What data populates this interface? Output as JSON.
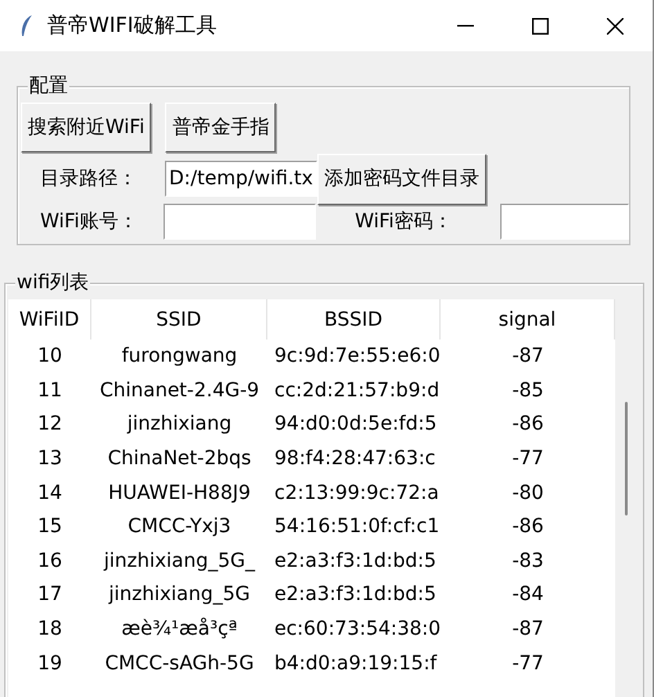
{
  "window": {
    "title": "普帝WIFI破解工具"
  },
  "config": {
    "title": "配置",
    "buttons": [
      "搜索附近WiFi",
      "普帝金手指"
    ],
    "path_label": "目录路径：",
    "path_value": "D:/temp/wifi.tx",
    "add_button": "添加密码文件目录",
    "account_label": "WiFi账号：",
    "password_label": "WiFi密码："
  },
  "wifi_list": {
    "title": "wifi列表",
    "columns": [
      "WiFiID",
      "SSID",
      "BSSID",
      "signal"
    ],
    "rows": [
      [
        "10",
        "furongwang",
        "9c:9d:7e:55:e6:0",
        "-87"
      ],
      [
        "11",
        "Chinanet-2.4G-9",
        "cc:2d:21:57:b9:d",
        "-85"
      ],
      [
        "12",
        "jinzhixiang",
        "94:d0:0d:5e:fd:5",
        "-86"
      ],
      [
        "13",
        "ChinaNet-2bqs",
        "98:f4:28:47:63:c",
        "-77"
      ],
      [
        "14",
        "HUAWEI-H88J9",
        "c2:13:99:9c:72:a",
        "-80"
      ],
      [
        "15",
        "CMCC-Yxj3",
        "54:16:51:0f:cf:c1",
        "-86"
      ],
      [
        "16",
        "jinzhixiang_5G_",
        "e2:a3:f3:1d:bd:5",
        "-83"
      ],
      [
        "17",
        "jinzhixiang_5G",
        "e2:a3:f3:1d:bd:5",
        "-84"
      ],
      [
        "18",
        "æè¾¹æå³çª",
        "ec:60:73:54:38:0",
        "-87"
      ],
      [
        "19",
        "CMCC-sAGh-5G",
        "b4:d0:a9:19:15:f",
        "-77"
      ]
    ]
  }
}
